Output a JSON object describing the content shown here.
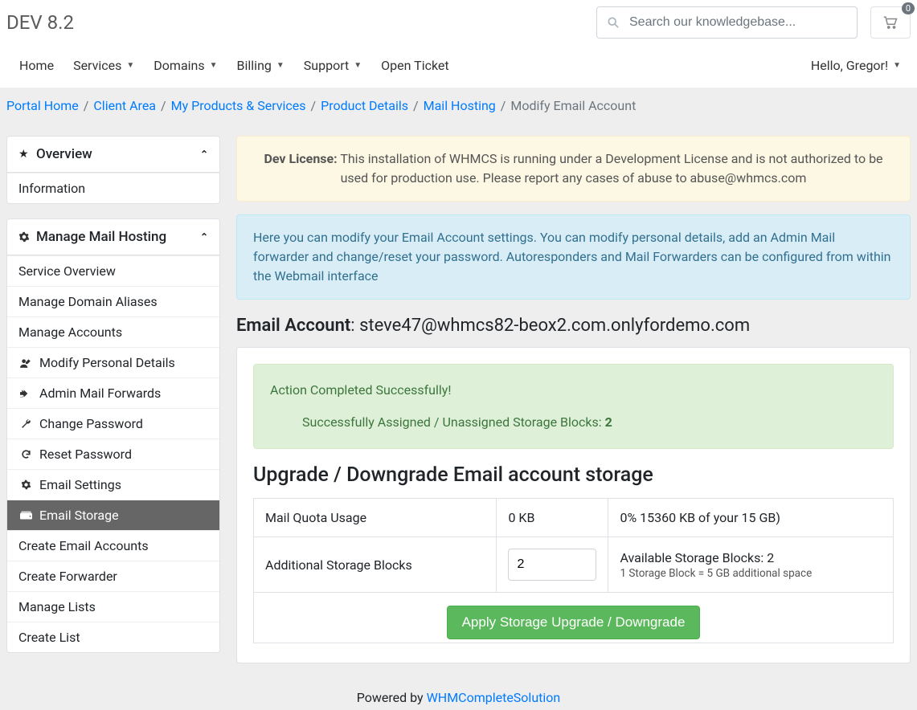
{
  "brand": "DEV 8.2",
  "search": {
    "placeholder": "Search our knowledgebase..."
  },
  "cart": {
    "count": "0"
  },
  "nav": {
    "home": "Home",
    "services": "Services",
    "domains": "Domains",
    "billing": "Billing",
    "support": "Support",
    "open_ticket": "Open Ticket",
    "greeting": "Hello, Gregor!"
  },
  "breadcrumb": {
    "portal": "Portal Home",
    "client": "Client Area",
    "products": "My Products & Services",
    "details": "Product Details",
    "mail": "Mail Hosting",
    "active": "Modify Email Account",
    "sep": "/"
  },
  "sidebar": {
    "overview_title": "Overview",
    "overview_items": {
      "information": "Information"
    },
    "manage_title": "Manage Mail Hosting",
    "manage_items": {
      "service_overview": "Service Overview",
      "domain_aliases": "Manage Domain Aliases",
      "manage_accounts": "Manage Accounts",
      "modify_personal": "Modify Personal Details",
      "admin_forwards": "Admin Mail Forwards",
      "change_password": "Change Password",
      "reset_password": "Reset Password",
      "email_settings": "Email Settings",
      "email_storage": "Email Storage",
      "create_accounts": "Create Email Accounts",
      "create_forwarder": "Create Forwarder",
      "manage_lists": "Manage Lists",
      "create_list": "Create List"
    }
  },
  "alerts": {
    "dev_label": "Dev License:",
    "dev_text": " This installation of WHMCS is running under a Development License and is not authorized to be used for production use. Please report any cases of abuse to abuse@whmcs.com",
    "info": "Here you can modify your Email Account settings. You can modify personal details, add an Admin Mail forwarder and change/reset your password. Autoresponders and Mail Forwarders can be configured from within the Webmail interface",
    "success_head": "Action Completed Successfully!",
    "success_sub_pre": "Successfully Assigned / Unassigned Storage Blocks: ",
    "success_sub_val": "2"
  },
  "email_account": {
    "label": "Email Account",
    "sep": ": ",
    "value": "steve47@whmcs82-beox2.com.onlyfordemo.com"
  },
  "storage": {
    "section_title": "Upgrade / Downgrade Email account storage",
    "row1_label": "Mail Quota Usage",
    "row1_val": "0 KB",
    "row1_desc": "0% 15360 KB of your 15 GB)",
    "row2_label": "Additional Storage Blocks",
    "row2_input": "2",
    "row2_avail": "Available Storage Blocks: 2",
    "row2_note": "1 Storage Block = 5 GB additional space",
    "apply_btn": "Apply Storage Upgrade / Downgrade"
  },
  "footer": {
    "powered": "Powered by ",
    "link": "WHMCompleteSolution"
  }
}
